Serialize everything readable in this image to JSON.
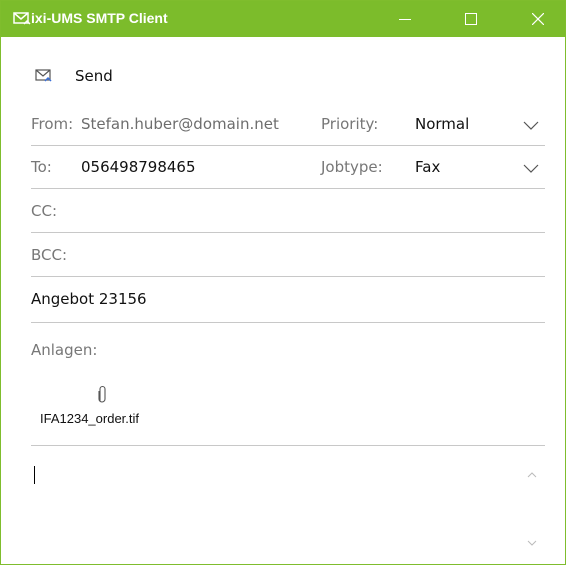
{
  "window": {
    "title": "ixi-UMS SMTP Client"
  },
  "toolbar": {
    "send_label": "Send"
  },
  "from": {
    "label": "From:",
    "value": "Stefan.huber@domain.net"
  },
  "priority": {
    "label": "Priority:",
    "value": "Normal"
  },
  "to": {
    "label": "To:",
    "value": "056498798465"
  },
  "jobtype": {
    "label": "Jobtype:",
    "value": "Fax"
  },
  "cc": {
    "label": "CC:",
    "value": ""
  },
  "bcc": {
    "label": "BCC:",
    "value": ""
  },
  "subject": {
    "value": "Angebot 23156"
  },
  "attachments": {
    "label": "Anlagen:",
    "items": [
      {
        "name": "IFA1234_order.tif",
        "icon": "paperclip-icon"
      }
    ]
  },
  "body": {
    "value": ""
  },
  "colors": {
    "titlebar": "#7cbc2b",
    "separator": "#c8c8c8",
    "label": "#777777"
  }
}
